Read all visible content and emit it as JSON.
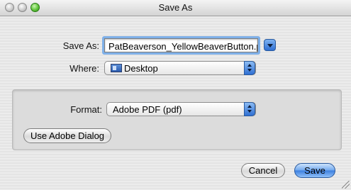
{
  "window": {
    "title": "Save As"
  },
  "save_as": {
    "label": "Save As:",
    "value": "PatBeaverson_YellowBeaverButton.pdf",
    "expand_icon": "disclosure-triangle-icon"
  },
  "where": {
    "label": "Where:",
    "value": "Desktop",
    "folder_icon": "desktop-folder-icon"
  },
  "format": {
    "label": "Format:",
    "value": "Adobe PDF (pdf)"
  },
  "buttons": {
    "use_adobe_dialog": "Use Adobe Dialog",
    "cancel": "Cancel",
    "save": "Save"
  },
  "colors": {
    "accent": "#3b7ee0",
    "focus_ring": "#7fb0e8"
  }
}
